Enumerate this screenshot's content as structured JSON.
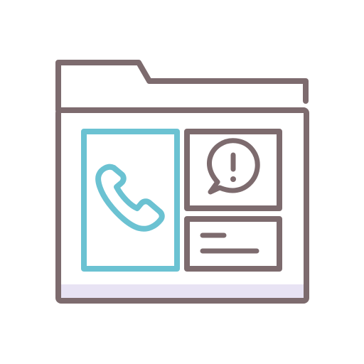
{
  "icon": {
    "name": "folder-contact-alert-icon",
    "parts": [
      "folder-icon",
      "phone-icon",
      "alert-speech-bubble-icon",
      "text-lines-icon"
    ]
  },
  "colors": {
    "outline": "#7d6b6e",
    "accent": "#6bc2d2",
    "shadow": "#e8e3f4",
    "background": "#ffffff"
  }
}
